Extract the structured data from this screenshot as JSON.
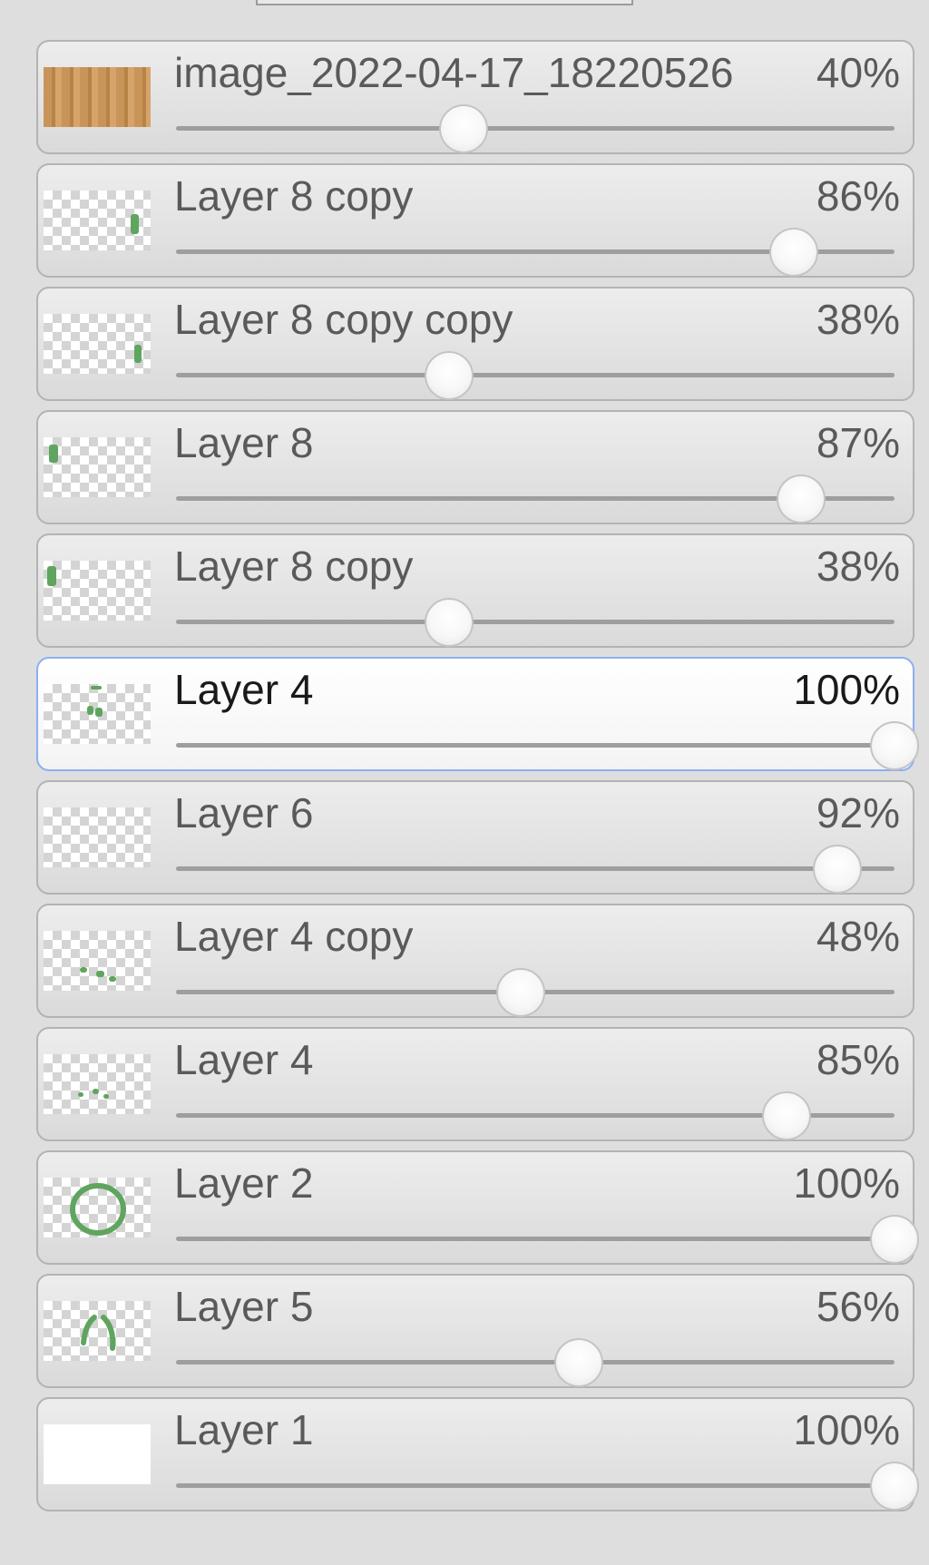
{
  "layers": [
    {
      "name": "image_2022-04-17_18220526",
      "opacity": "40%",
      "value": 0.4,
      "thumb": "wood-image",
      "selected": false
    },
    {
      "name": "Layer 8 copy",
      "opacity": "86%",
      "value": 0.86,
      "thumb": "green-mark-right",
      "selected": false
    },
    {
      "name": "Layer 8 copy copy",
      "opacity": "38%",
      "value": 0.38,
      "thumb": "green-mark-right-low",
      "selected": false
    },
    {
      "name": "Layer 8",
      "opacity": "87%",
      "value": 0.87,
      "thumb": "green-mark-left",
      "selected": false
    },
    {
      "name": "Layer 8 copy",
      "opacity": "38%",
      "value": 0.38,
      "thumb": "green-mark-left-low",
      "selected": false
    },
    {
      "name": "Layer 4",
      "opacity": "100%",
      "value": 1.0,
      "thumb": "green-marks-center",
      "selected": true
    },
    {
      "name": "Layer 6",
      "opacity": "92%",
      "value": 0.92,
      "thumb": "empty",
      "selected": false
    },
    {
      "name": "Layer 4 copy",
      "opacity": "48%",
      "value": 0.48,
      "thumb": "green-dots",
      "selected": false
    },
    {
      "name": "Layer 4",
      "opacity": "85%",
      "value": 0.85,
      "thumb": "green-dots-small",
      "selected": false
    },
    {
      "name": "Layer 2",
      "opacity": "100%",
      "value": 1.0,
      "thumb": "green-ring",
      "selected": false
    },
    {
      "name": "Layer 5",
      "opacity": "56%",
      "value": 0.56,
      "thumb": "green-arcs",
      "selected": false
    },
    {
      "name": "Layer 1",
      "opacity": "100%",
      "value": 1.0,
      "thumb": "white-fill",
      "selected": false
    }
  ]
}
